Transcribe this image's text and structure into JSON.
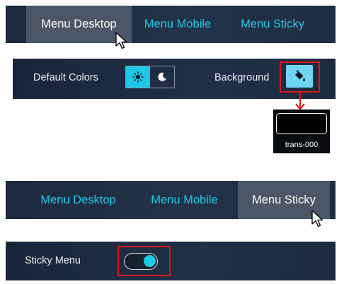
{
  "top_menu": {
    "tabs": [
      {
        "label": "Menu Desktop",
        "active": true
      },
      {
        "label": "Menu Mobile",
        "active": false
      },
      {
        "label": "Menu Sticky",
        "active": false
      }
    ]
  },
  "colors_row": {
    "default_colors_label": "Default Colors",
    "mode_options": [
      {
        "icon": "sun-icon",
        "selected": true
      },
      {
        "icon": "moon-icon",
        "selected": false
      }
    ],
    "background_label": "Background",
    "background_button_icon": "paint-bucket-icon"
  },
  "background_popup": {
    "swatch_color": "#000000",
    "swatch_label": "trans-000"
  },
  "bottom_menu": {
    "tabs": [
      {
        "label": "Menu Desktop",
        "active": false
      },
      {
        "label": "Menu Mobile",
        "active": false
      },
      {
        "label": "Menu Sticky",
        "active": true
      }
    ]
  },
  "sticky_row": {
    "label": "Sticky Menu",
    "toggle_on": true
  },
  "colors": {
    "accent": "#1ec8e6",
    "active_tab": "#4b5666",
    "highlight": "#e0141c",
    "panel_bg": "#1f3047"
  }
}
